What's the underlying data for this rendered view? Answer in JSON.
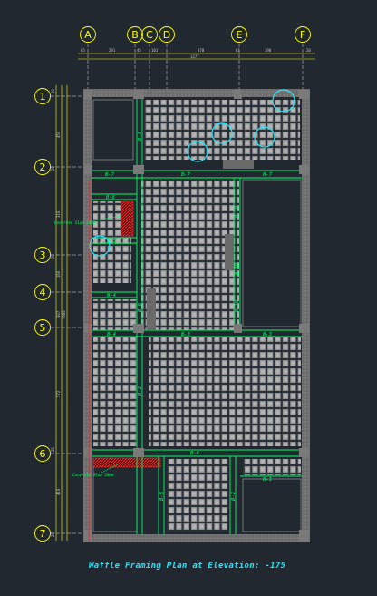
{
  "drawing": {
    "title": "Waffle Framing Plan at Elevation: -175",
    "colors": {
      "background": "#212830",
      "concrete": "#8a8a8a",
      "waffle_cell": "#9a9a9a",
      "beam_line": "#00ff66",
      "grid_bubble": "#ffff00",
      "cyan_marker": "#22e6ff",
      "slab_hatch": "#c02020"
    }
  },
  "grid_columns": [
    {
      "id": "A",
      "label": "A"
    },
    {
      "id": "B",
      "label": "B"
    },
    {
      "id": "C",
      "label": "C"
    },
    {
      "id": "D",
      "label": "D"
    },
    {
      "id": "E",
      "label": "E"
    },
    {
      "id": "F",
      "label": "F"
    }
  ],
  "grid_rows": [
    {
      "id": "1",
      "label": "1"
    },
    {
      "id": "2",
      "label": "2"
    },
    {
      "id": "3",
      "label": "3"
    },
    {
      "id": "4",
      "label": "4"
    },
    {
      "id": "5",
      "label": "5"
    },
    {
      "id": "6",
      "label": "6"
    },
    {
      "id": "7",
      "label": "7"
    }
  ],
  "dimensions_top": [
    "65",
    "291",
    "45",
    "101",
    "470",
    "61",
    "390",
    "20"
  ],
  "dimension_top_total": "1377",
  "dimensions_left": [
    "20",
    "450",
    "20",
    "310",
    "20",
    "160",
    "307",
    "1080",
    "572",
    "26",
    "410",
    "20"
  ],
  "beam_labels": {
    "b7_left": "B-7",
    "b7_mid": "B-7",
    "b7_right": "B-7",
    "b8_top": "B-8",
    "b5_left": "B-5",
    "b4_left": "B-4",
    "b4_left2": "B-4",
    "b3_mid": "B-3",
    "b3_right": "B-3",
    "b3_vert": "B-3",
    "b6_long": "B-6",
    "b1": "B-1",
    "b9_a": "B-9",
    "b9_b": "B-9",
    "b10_a": "B-10",
    "b10_b": "B-10",
    "b10_c": "B-10",
    "b2": "B-2"
  },
  "annotations": {
    "slab_upper": "Concrete Slab 20mm",
    "slab_lower": "Concrete Slab 20mm"
  }
}
